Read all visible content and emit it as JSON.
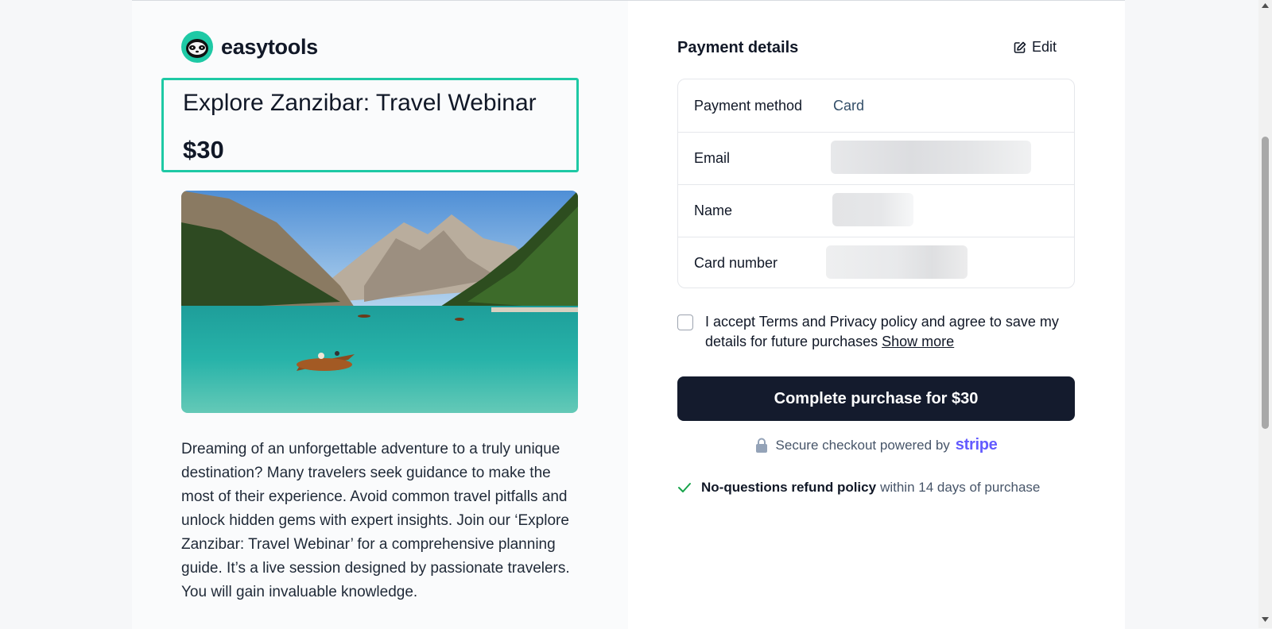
{
  "brand": {
    "name": "easytools"
  },
  "product": {
    "title": "Explore Zanzibar: Travel Webinar",
    "price": "$30",
    "description": "Dreaming of an unforgettable adventure to a truly unique destination? Many travelers seek guidance to make the most of their experience. Avoid common travel pitfalls and unlock hidden gems with expert insights. Join our ‘Explore Zanzibar: Travel Webinar’ for a comprehensive planning guide. It’s a live session designed by passionate travelers. You will gain invaluable knowledge."
  },
  "payment": {
    "title": "Payment details",
    "edit_label": "Edit",
    "rows": [
      {
        "label": "Payment method",
        "value": "Card"
      },
      {
        "label": "Email",
        "value": ""
      },
      {
        "label": "Name",
        "value": ""
      },
      {
        "label": "Card number",
        "value": ""
      }
    ]
  },
  "consent": {
    "text": "I accept Terms and Privacy policy and agree to save my details for future purchases",
    "show_more": "Show more",
    "checked": false
  },
  "purchase_button": "Complete purchase for $30",
  "secure": {
    "text": "Secure checkout powered by",
    "provider": "stripe"
  },
  "refund": {
    "strong": "No-questions refund policy",
    "rest": "within 14 days of purchase"
  },
  "colors": {
    "accent": "#1ec9a5",
    "button": "#141b2d",
    "stripe": "#635bff"
  }
}
